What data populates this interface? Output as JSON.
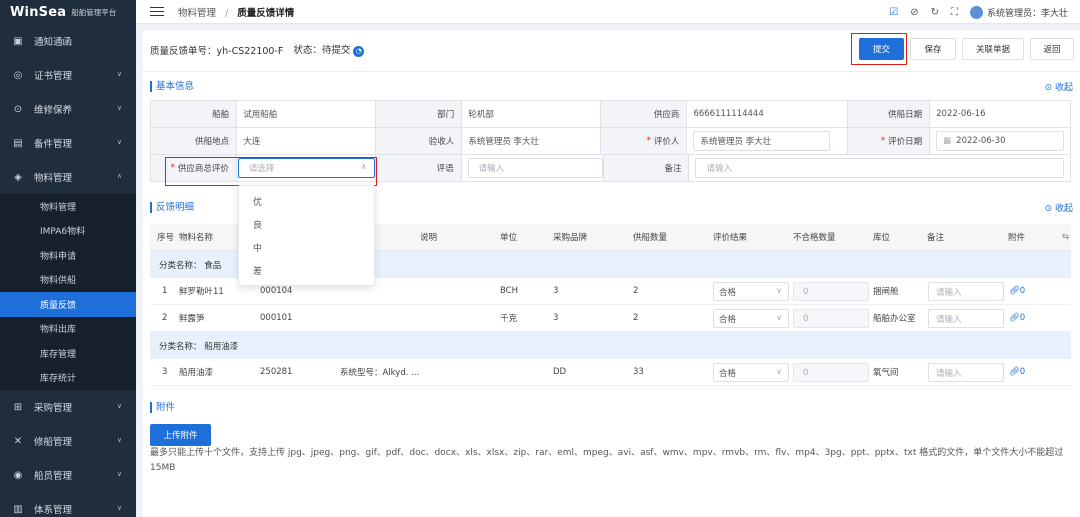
{
  "app": {
    "brand": "WinSea",
    "subtitle": "船舶管理平台"
  },
  "sidebar": {
    "items": [
      {
        "label": "通知通函",
        "icon": "notice-icon"
      },
      {
        "label": "证书管理",
        "icon": "certificate-icon"
      },
      {
        "label": "维修保养",
        "icon": "maintenance-icon"
      },
      {
        "label": "备件管理",
        "icon": "spare-parts-icon"
      },
      {
        "label": "物料管理",
        "icon": "material-icon"
      },
      {
        "label": "采购管理",
        "icon": "cart-icon"
      },
      {
        "label": "修船管理",
        "icon": "repair-icon"
      },
      {
        "label": "船员管理",
        "icon": "crew-icon"
      },
      {
        "label": "体系管理",
        "icon": "system-icon"
      }
    ],
    "sub_items": [
      "物料管理",
      "IMPA6物料",
      "物料申请",
      "物料供船",
      "质量反馈",
      "物料出库",
      "库存管理",
      "库存统计"
    ],
    "active_sub": "质量反馈"
  },
  "header": {
    "breadcrumb_parent": "物料管理",
    "breadcrumb_sep": "/",
    "breadcrumb_current": "质量反馈详情",
    "user_label": "系统管理员：李大壮"
  },
  "topbar": {
    "order_no": "质量反馈单号：yh-CS22100-F",
    "status": "状态：待提交",
    "buttons": {
      "submit": "提交",
      "save": "保存",
      "link": "关联单据",
      "back": "返回"
    }
  },
  "basic": {
    "title": "基本信息",
    "collapse": "收起",
    "rows": [
      [
        {
          "label": "船舶",
          "value": "试用船舶"
        },
        {
          "label": "部门",
          "value": "轮机部"
        },
        {
          "label": "供应商",
          "value": "6666111114444"
        },
        {
          "label": "供船日期",
          "value": "2022-06-16"
        }
      ],
      [
        {
          "label": "供船地点",
          "value": "大连"
        },
        {
          "label": "验收人",
          "value": "系统管理员 李大壮"
        },
        {
          "label": "评价人",
          "value": "系统管理员  李大壮"
        },
        {
          "label": "评价日期",
          "value": "2022-06-30"
        }
      ],
      [
        {
          "label": "供应商总评价",
          "value": "请选择"
        },
        {
          "label": "评语",
          "value": "请输入"
        },
        {
          "label": "备注",
          "value": "请输入"
        }
      ]
    ]
  },
  "dropdown_options": [
    "优",
    "良",
    "中",
    "差"
  ],
  "feedback": {
    "title": "反馈明细",
    "collapse": "收起",
    "columns": [
      "序号",
      "物料名称",
      "说明",
      "单位",
      "采购品牌",
      "供船数量",
      "评价结果",
      "不合格数量",
      "库位",
      "备注",
      "附件"
    ],
    "groups": [
      {
        "category": "分类名称：  食品",
        "rows": [
          {
            "no": "1",
            "name": "鲜罗勒叶11",
            "code": "000104",
            "desc": "",
            "unit": "BCH",
            "brand": "3",
            "qty": "2",
            "result": "合格",
            "bad": "0",
            "location": "捆闸舱",
            "remark": "请输入",
            "att": "0"
          },
          {
            "no": "2",
            "name": "鲜露笋",
            "code": "000101",
            "desc": "",
            "unit": "千克",
            "brand": "3",
            "qty": "2",
            "result": "合格",
            "bad": "0",
            "location": "船舶办公室",
            "remark": "请输入",
            "att": "0"
          }
        ]
      },
      {
        "category": "分类名称：  船用油漆",
        "rows": [
          {
            "no": "3",
            "name": "船用油漆",
            "code": "250281",
            "desc": "系统型号：Alkyd. ...",
            "unit": "",
            "brand": "DD",
            "qty": "33",
            "result": "合格",
            "bad": "0",
            "location": "氧气间",
            "remark": "请输入",
            "att": "0"
          }
        ]
      }
    ]
  },
  "attachments": {
    "title": "附件",
    "upload_label": "上传附件",
    "note": "最多只能上传十个文件，支持上传 jpg、jpeg、png、gif、pdf、doc、docx、xls、xlsx、zip、rar、eml、mpeg、avi、asf、wmv、mpv、rmvb、rm、flv、mp4、3pg、ppt、pptx、txt 格式的文件，单个文件大小不能超过15MB"
  },
  "colors": {
    "sidebar_bg": "#1f2d3d",
    "accent": "#1e6fd9",
    "highlight_box": "#e21b1b"
  }
}
